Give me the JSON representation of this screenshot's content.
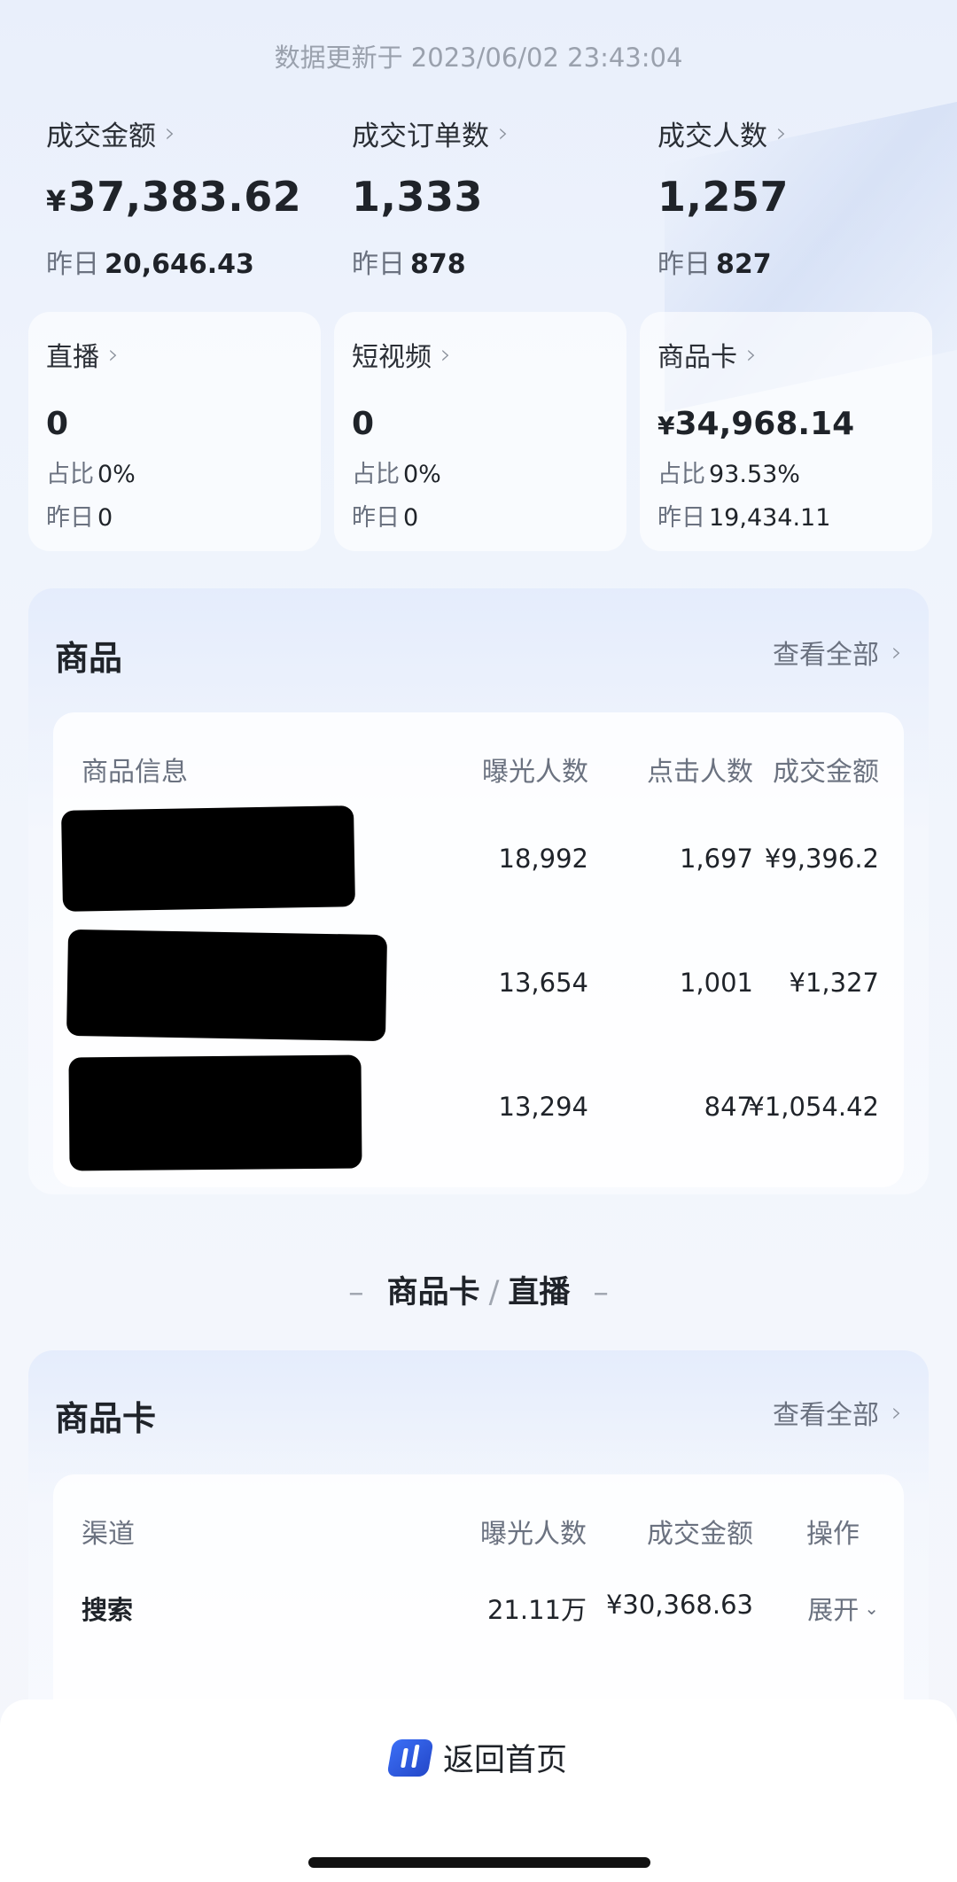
{
  "update_time": "数据更新于 2023/06/02 23:43:04",
  "kpis": [
    {
      "label": "成交金额",
      "currency": "¥",
      "value": "37,383.62",
      "yesterday_label": "昨日",
      "yesterday": "20,646.43"
    },
    {
      "label": "成交订单数",
      "currency": "",
      "value": "1,333",
      "yesterday_label": "昨日",
      "yesterday": "878"
    },
    {
      "label": "成交人数",
      "currency": "",
      "value": "1,257",
      "yesterday_label": "昨日",
      "yesterday": "827"
    }
  ],
  "channels": [
    {
      "label": "直播",
      "currency": "",
      "value": "0",
      "share_label": "占比",
      "share": "0%",
      "yesterday_label": "昨日",
      "yesterday": "0"
    },
    {
      "label": "短视频",
      "currency": "",
      "value": "0",
      "share_label": "占比",
      "share": "0%",
      "yesterday_label": "昨日",
      "yesterday": "0"
    },
    {
      "label": "商品卡",
      "currency": "¥",
      "value": "34,968.14",
      "share_label": "占比",
      "share": "93.53%",
      "yesterday_label": "昨日",
      "yesterday": "19,434.11"
    }
  ],
  "products": {
    "title": "商品",
    "view_all": "查看全部",
    "headers": [
      "商品信息",
      "曝光人数",
      "点击人数",
      "成交金额"
    ],
    "rows": [
      {
        "exposure": "18,992",
        "clicks": "1,697",
        "amount": "¥9,396.2"
      },
      {
        "exposure": "13,654",
        "clicks": "1,001",
        "amount": "¥1,327"
      },
      {
        "exposure": "13,294",
        "clicks": "847",
        "amount": "¥1,054.42"
      }
    ]
  },
  "divider": {
    "left": "商品卡",
    "sep": "/",
    "right": "直播",
    "dash": "–"
  },
  "product_card": {
    "title": "商品卡",
    "view_all": "查看全部",
    "headers": [
      "渠道",
      "曝光人数",
      "成交金额",
      "操作"
    ],
    "rows": [
      {
        "channel": "搜索",
        "exposure": "21.11万",
        "amount": "¥30,368.63",
        "action": "展开"
      }
    ]
  },
  "bottom": {
    "home_label": "返回首页"
  }
}
